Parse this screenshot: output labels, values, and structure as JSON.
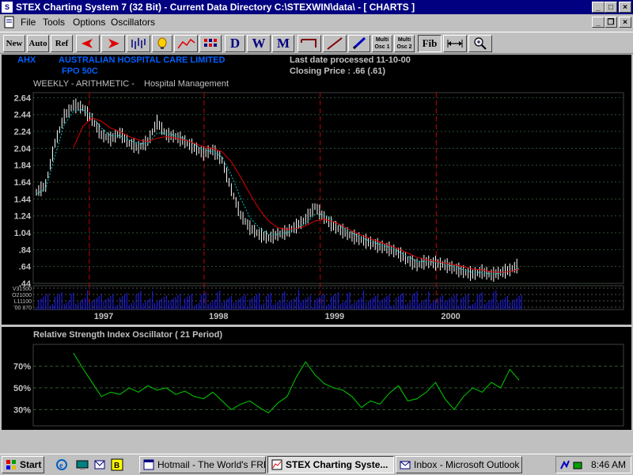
{
  "window": {
    "title": "STEX Charting System 7 (32 Bit)  -  Current Data Directory C:\\STEXWIN\\data\\ - [  CHARTS    ]"
  },
  "menu": [
    "File",
    "Tools",
    "Options",
    "Oscillators"
  ],
  "toolbar": {
    "new": "New",
    "auto": "Auto",
    "ref": "Ref",
    "d": "D",
    "w": "W",
    "m": "M",
    "multi1": "Multi Osc 1",
    "multi2": "Multi Osc 2",
    "fib": "Fib",
    "icons": [
      "left-arrow-icon",
      "right-arrow-icon",
      "bar-chart-icon",
      "lamp-icon",
      "line-chart-icon",
      "grid-icon",
      "bracket-icon",
      "trendline-icon",
      "pencil-icon",
      "expand-icon",
      "zoom-icon"
    ]
  },
  "stock": {
    "code": "AHX",
    "name": "AUSTRALIAN HOSPITAL CARE LIMITED",
    "sub": "FPO 50C",
    "last_date": "Last date processed 11-10-00",
    "closing": "Closing Price : .66  (.61)",
    "mode": "WEEKLY - ARITHMETIC -",
    "sector": "Hospital Management"
  },
  "chart_data": {
    "type": "line",
    "title": "",
    "price_axis": {
      "ticks": [
        "2.64",
        "2.44",
        "2.24",
        "2.04",
        "1.84",
        "1.64",
        "1.44",
        "1.24",
        "1.04",
        ".84",
        ".64",
        ".44"
      ],
      "ylim": [
        0.44,
        2.7
      ]
    },
    "volume_axis": {
      "ticks": [
        "V31500",
        "O21000",
        "L11100",
        "'00  870"
      ]
    },
    "x_axis": {
      "labels": [
        "1997",
        "1998",
        "1999",
        "2000"
      ]
    },
    "series": [
      {
        "color": "#ffffff",
        "x": [
          0,
          4,
          8,
          12,
          16,
          20,
          24,
          28,
          32,
          36,
          40,
          44,
          48,
          52,
          56,
          60,
          64,
          68,
          72,
          76,
          80,
          84,
          88,
          92,
          96,
          100,
          104,
          108,
          112,
          116,
          120,
          124,
          128,
          132,
          136,
          140,
          144,
          148,
          152,
          156,
          160,
          164,
          168,
          172,
          176,
          180,
          184,
          188,
          192,
          196,
          200,
          204,
          208
        ],
        "values": [
          1.52,
          1.6,
          2.1,
          2.42,
          2.55,
          2.52,
          2.38,
          2.2,
          2.15,
          2.22,
          2.1,
          2.05,
          2.12,
          2.35,
          2.2,
          2.18,
          2.12,
          2.05,
          1.98,
          2.02,
          1.9,
          1.55,
          1.25,
          1.1,
          1.02,
          0.98,
          1.02,
          1.05,
          1.12,
          1.2,
          1.35,
          1.22,
          1.12,
          1.06,
          1.0,
          0.96,
          0.92,
          0.88,
          0.85,
          0.8,
          0.72,
          0.66,
          0.7,
          0.68,
          0.66,
          0.62,
          0.58,
          0.55,
          0.58,
          0.54,
          0.57,
          0.6,
          0.66
        ]
      },
      {
        "color": "#00c8c8",
        "x": [
          0,
          4,
          8,
          12,
          16,
          20,
          24,
          28,
          32,
          36,
          40,
          44,
          48,
          52,
          56,
          60,
          64,
          68,
          72,
          76,
          80,
          84,
          88,
          92,
          96,
          100,
          104,
          108,
          112,
          116,
          120,
          124,
          128,
          132,
          136,
          140,
          144,
          148,
          152,
          156,
          160,
          164,
          168,
          172,
          176,
          180,
          184,
          188,
          192,
          196,
          200,
          204,
          208
        ],
        "values": [
          1.5,
          1.56,
          1.95,
          2.32,
          2.48,
          2.5,
          2.42,
          2.28,
          2.19,
          2.19,
          2.14,
          2.09,
          2.1,
          2.22,
          2.22,
          2.19,
          2.15,
          2.09,
          2.02,
          2.0,
          1.94,
          1.72,
          1.45,
          1.22,
          1.1,
          1.02,
          1.02,
          1.04,
          1.09,
          1.15,
          1.26,
          1.26,
          1.18,
          1.1,
          1.04,
          0.98,
          0.94,
          0.9,
          0.87,
          0.82,
          0.76,
          0.7,
          0.7,
          0.69,
          0.67,
          0.64,
          0.6,
          0.57,
          0.57,
          0.55,
          0.56,
          0.58,
          0.62
        ]
      },
      {
        "color": "#e00000",
        "x": [
          16,
          20,
          24,
          28,
          32,
          36,
          40,
          44,
          48,
          52,
          56,
          60,
          64,
          68,
          72,
          76,
          80,
          84,
          88,
          92,
          96,
          100,
          104,
          108,
          112,
          116,
          120,
          124,
          128,
          132,
          136,
          140,
          144,
          148,
          152,
          156,
          160,
          164,
          168,
          172,
          176,
          180,
          184,
          188,
          192,
          196,
          200,
          204,
          208
        ],
        "values": [
          2.05,
          2.3,
          2.4,
          2.36,
          2.28,
          2.24,
          2.18,
          2.14,
          2.12,
          2.16,
          2.18,
          2.16,
          2.14,
          2.1,
          2.06,
          2.04,
          2.0,
          1.88,
          1.7,
          1.5,
          1.32,
          1.18,
          1.1,
          1.08,
          1.09,
          1.12,
          1.18,
          1.2,
          1.17,
          1.12,
          1.06,
          1.01,
          0.97,
          0.93,
          0.89,
          0.85,
          0.8,
          0.75,
          0.72,
          0.7,
          0.68,
          0.66,
          0.64,
          0.61,
          0.6,
          0.58,
          0.57,
          0.58,
          0.61
        ]
      }
    ],
    "xlim": [
      0,
      210
    ],
    "rsi": {
      "title": "Relative Strength Index Oscillator ( 21 Period)",
      "ticks": [
        "70%",
        "50%",
        "30%"
      ],
      "ylim": [
        15,
        90
      ],
      "x": [
        16,
        20,
        24,
        28,
        32,
        36,
        40,
        44,
        48,
        52,
        56,
        60,
        64,
        68,
        72,
        76,
        80,
        84,
        88,
        92,
        96,
        100,
        104,
        108,
        112,
        116,
        120,
        124,
        128,
        132,
        136,
        140,
        144,
        148,
        152,
        156,
        160,
        164,
        168,
        172,
        176,
        180,
        184,
        188,
        192,
        196,
        200,
        204,
        208
      ],
      "values": [
        82,
        68,
        55,
        42,
        46,
        44,
        50,
        46,
        52,
        48,
        50,
        44,
        47,
        42,
        40,
        46,
        38,
        30,
        35,
        38,
        32,
        27,
        36,
        42,
        60,
        74,
        62,
        54,
        50,
        48,
        42,
        32,
        38,
        35,
        45,
        52,
        38,
        40,
        46,
        55,
        40,
        30,
        42,
        50,
        46,
        55,
        50,
        67,
        57
      ]
    }
  },
  "taskbar": {
    "start": "Start",
    "tasks": [
      "Hotmail - The World's FRE...",
      "STEX Charting Syste...",
      "Inbox - Microsoft Outlook"
    ],
    "clock": "8:46 AM"
  }
}
